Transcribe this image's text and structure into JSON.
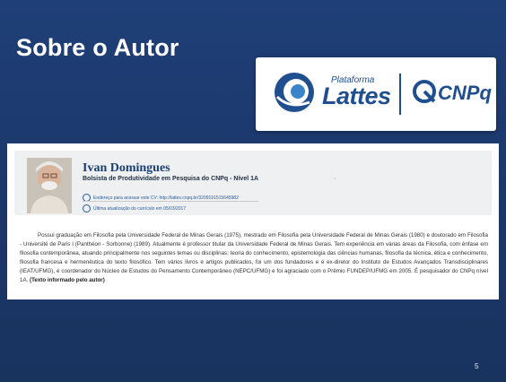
{
  "slide": {
    "title": "Sobre o Autor",
    "page_number": "5"
  },
  "logos": {
    "plataforma": "Plataforma",
    "lattes": "Lattes",
    "cnpq": "CNPq"
  },
  "profile": {
    "name": "Ivan Domingues",
    "subtitle": "Bolsista de Produtividade em Pesquisa do CNPq - Nível 1A",
    "dot": "·",
    "cv_link": "Endereço para acessar este CV: http://lattes.cnpq.br/3209191515645982",
    "last_update": "Última atualização do currículo em 05/03/2017",
    "bio_text": "Possui graduação em Filosofia pela Universidade Federal de Minas Gerais (1975), mestrado em Filosofia pela Universidade Federal de Minas Gerais (1980) e doutorado em Filosofia - Université de Paris I (Panthéon - Sorbonne) (1989). Atualmente é professor titular da Universidade Federal de Minas Gerais. Tem experiência em várias áreas da Filosofia, com ênfase em filosofia contemporânea, atuando principalmente nos seguintes temas ou disciplinas: teoria do conhecimento, epistemologia das ciências humanas, filosofia da técnica, ética e conhecimento, filosofia francesa e hermenêutica do texto filosófico. Tem vários livros e artigos publicados, foi um dos fundadores e é ex-diretor do Instituto de Estudos Avançados Transdisciplinares (IEAT/UFMG), é coordenador do Núcleo de Estudos do Pensamento Contemporâneo (NEPC/UFMG) e foi agraciado com o Prêmio FUNDEP/UFMG em 2005. É pesquisador do CNPq nível 1A. ",
    "bio_source": "(Texto informado pelo autor)"
  }
}
